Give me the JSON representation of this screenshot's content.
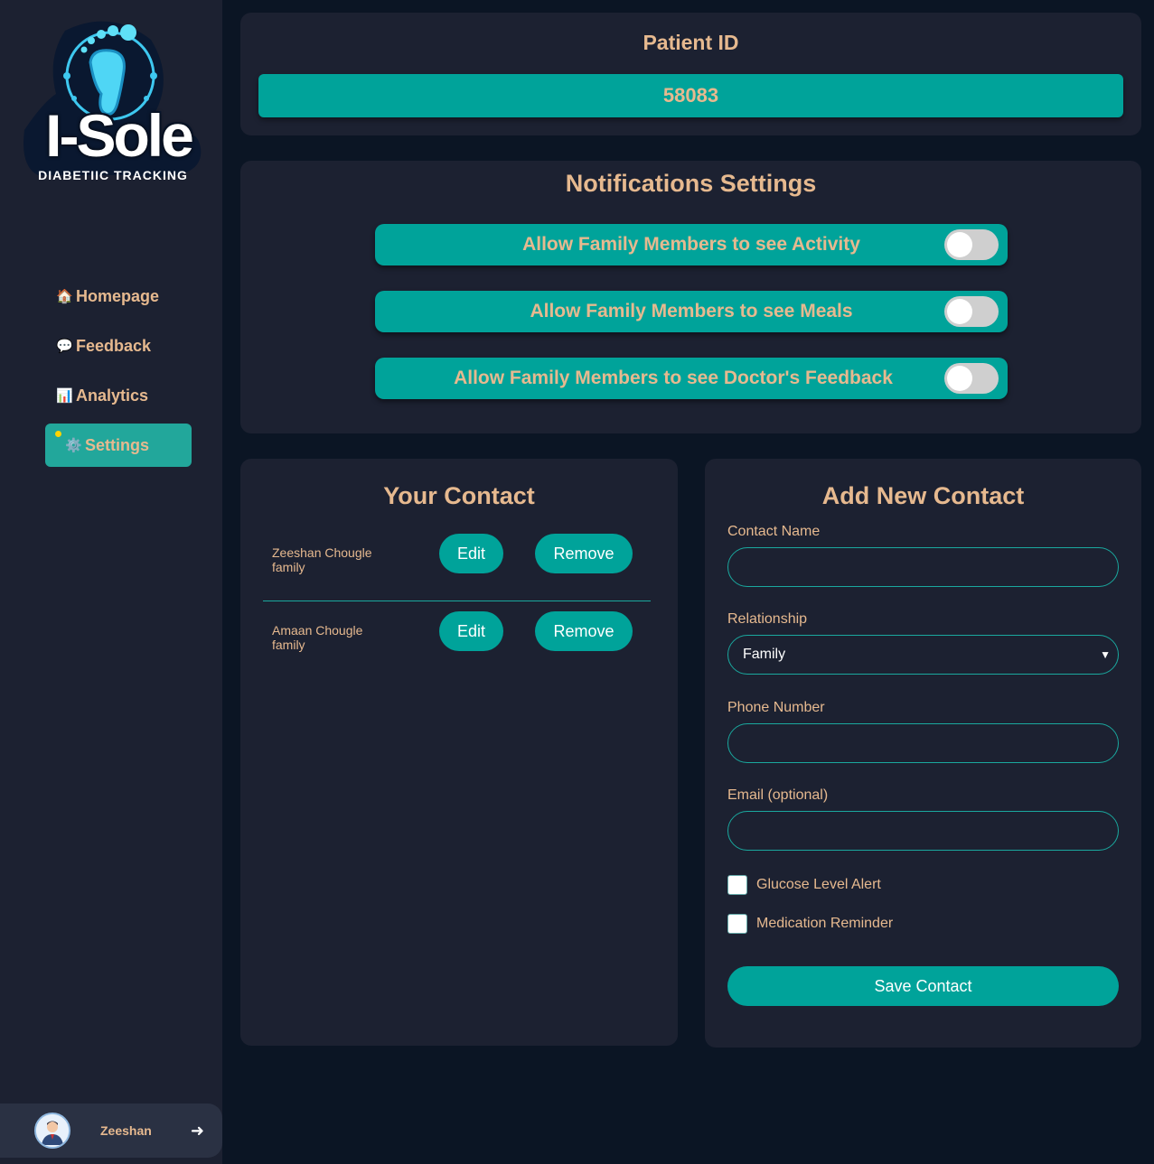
{
  "app": {
    "logo_word": "I-Sole",
    "logo_tagline": "DIABETIIC TRACKING"
  },
  "sidebar": {
    "items": [
      {
        "label": "Homepage",
        "icon": "house-icon",
        "glyph": "🏠",
        "active": false
      },
      {
        "label": "Feedback",
        "icon": "speech-bubble-icon",
        "glyph": "💬",
        "active": false
      },
      {
        "label": "Analytics",
        "icon": "bar-chart-icon",
        "glyph": "📊",
        "active": false
      },
      {
        "label": "Settings",
        "icon": "gear-icon",
        "glyph": "⚙️",
        "active": true
      }
    ],
    "user": {
      "name": "Zeeshan",
      "logout_glyph": "➜"
    }
  },
  "patient": {
    "title": "Patient ID",
    "id": "58083"
  },
  "notifications": {
    "title": "Notifications Settings",
    "toggles": [
      {
        "label": "Allow Family Members to see Activity",
        "on": false
      },
      {
        "label": "Allow Family Members to see Meals",
        "on": false
      },
      {
        "label": "Allow Family Members to see Doctor's Feedback",
        "on": false
      }
    ]
  },
  "contacts": {
    "title": "Your Contact",
    "edit_label": "Edit",
    "remove_label": "Remove",
    "items": [
      {
        "name": "Zeeshan Chougle",
        "relationship": "family"
      },
      {
        "name": "Amaan Chougle",
        "relationship": "family"
      }
    ]
  },
  "add_contact": {
    "title": "Add New Contact",
    "name_label": "Contact Name",
    "name_value": "",
    "relationship_label": "Relationship",
    "relationship_value": "Family",
    "phone_label": "Phone Number",
    "phone_value": "",
    "email_label": "Email (optional)",
    "email_value": "",
    "glucose_label": "Glucose Level Alert",
    "medication_label": "Medication Reminder",
    "save_label": "Save Contact"
  },
  "colors": {
    "accent": "#00a39a",
    "text_accent": "#e6b98f",
    "panel": "#1c2131",
    "background": "#0b1524"
  }
}
